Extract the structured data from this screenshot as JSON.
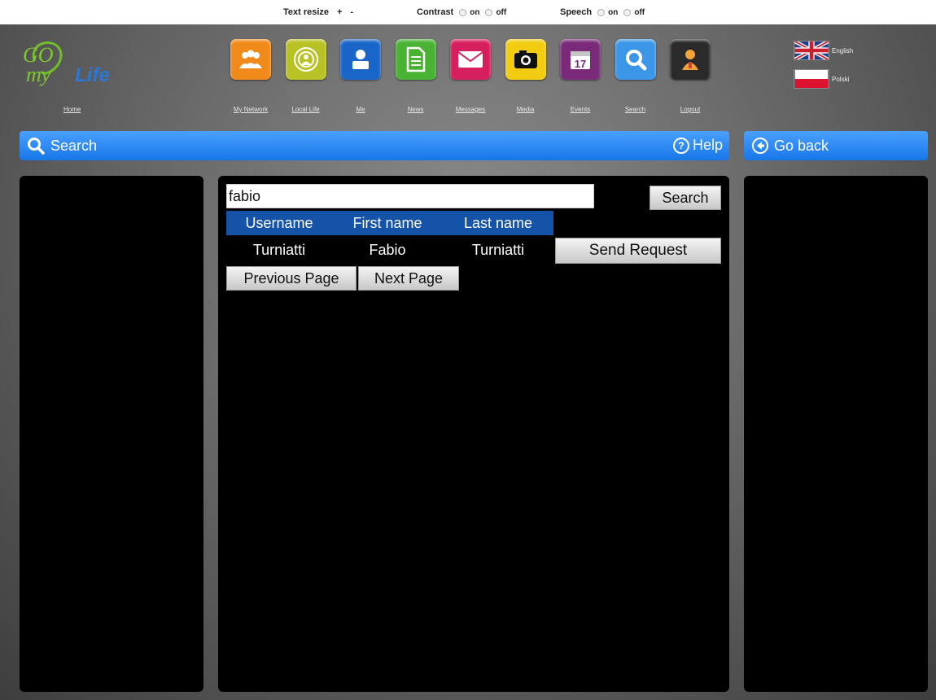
{
  "accessibility": {
    "text_resize_label": "Text resize",
    "increase": "+",
    "decrease": "-",
    "contrast_label": "Contrast",
    "speech_label": "Speech",
    "on": "on",
    "off": "off"
  },
  "logo": {
    "text_go": "GO",
    "text_my": "my",
    "text_life": "Life"
  },
  "home_label": "Home",
  "nav": [
    {
      "label": "My Network",
      "icon": "people-icon",
      "color": "#f08a1a"
    },
    {
      "label": "Local Life",
      "icon": "target-icon",
      "color": "#b9c224"
    },
    {
      "label": "Me",
      "icon": "person-icon",
      "color": "#1a66c8"
    },
    {
      "label": "News",
      "icon": "document-icon",
      "color": "#49b233"
    },
    {
      "label": "Messages",
      "icon": "envelope-icon",
      "color": "#d61f5e"
    },
    {
      "label": "Media",
      "icon": "camera-icon",
      "color": "#f2cc10"
    },
    {
      "label": "Events",
      "icon": "calendar-icon",
      "color": "#7a2a78"
    },
    {
      "label": "Search",
      "icon": "magnifier-icon",
      "color": "#3b96e8"
    },
    {
      "label": "Logout",
      "icon": "logout-icon",
      "color": "#2a2a2a"
    }
  ],
  "languages": [
    {
      "label": "English",
      "flag": "uk-flag-icon"
    },
    {
      "label": "Polski",
      "flag": "poland-flag-icon"
    }
  ],
  "search_bar": {
    "title": "Search",
    "help": "Help",
    "help_symbol": "?"
  },
  "back_bar": {
    "title": "Go back"
  },
  "search": {
    "value": "fabio",
    "button": "Search"
  },
  "results": {
    "columns": [
      "Username",
      "First name",
      "Last name"
    ],
    "rows": [
      {
        "username": "Turniatti",
        "first_name": "Fabio",
        "last_name": "Turniatti",
        "action": "Send Request"
      }
    ]
  },
  "pagination": {
    "previous": "Previous Page",
    "next": "Next Page"
  },
  "colors": {
    "accent_blue": "#1876e8",
    "header_blue": "#1553a8",
    "panel_bg": "#000000"
  }
}
